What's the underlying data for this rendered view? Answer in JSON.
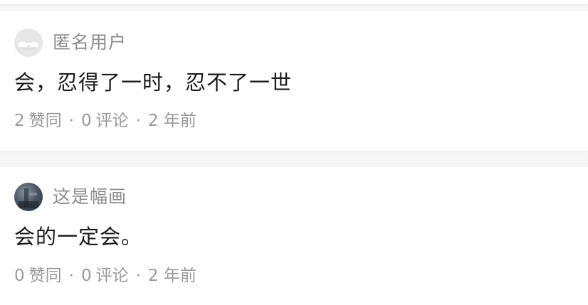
{
  "separator": "·",
  "answers": [
    {
      "author": "匿名用户",
      "avatar": "anonymous-avatar-icon",
      "content": "会，忍得了一时，忍不了一世",
      "likes": "2",
      "likes_label": "赞同",
      "comments": "0",
      "comments_label": "评论",
      "time": "2 年前"
    },
    {
      "author": "这是幅画",
      "avatar": "user-photo-avatar",
      "content": "会的一定会。",
      "likes": "0",
      "likes_label": "赞同",
      "comments": "0",
      "comments_label": "评论",
      "time": "2 年前"
    }
  ],
  "colors": {
    "background": "#f6f6f6",
    "card": "#ffffff",
    "author": "#8c8c8c",
    "content": "#1a1a1a",
    "meta": "#9a9a9a"
  }
}
